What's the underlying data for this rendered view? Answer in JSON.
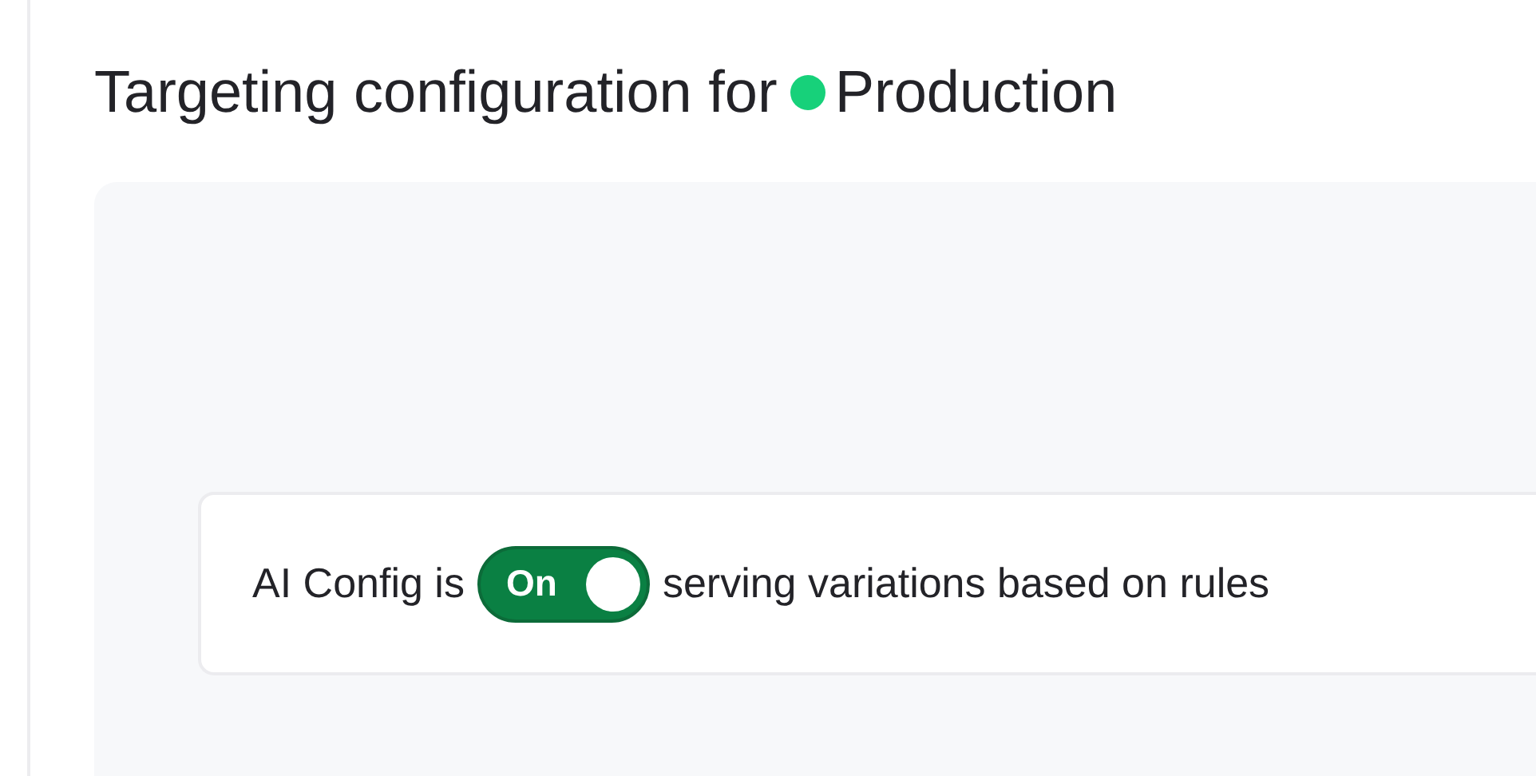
{
  "heading": {
    "text": "Targeting configuration for",
    "environment": "Production",
    "color": "#17d17a"
  },
  "status": {
    "prefix": "AI Config is",
    "toggle": {
      "label": "On",
      "on": true
    },
    "suffix": "serving variations based on rules"
  }
}
